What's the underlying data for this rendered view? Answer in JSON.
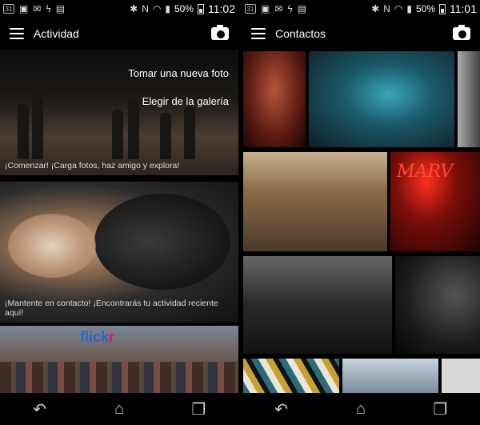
{
  "left": {
    "status": {
      "time": "11:02",
      "battery": "50%",
      "calendar": "31"
    },
    "app_title": "Actividad",
    "menu": [
      "Tomar una nueva foto",
      "Elegir de la galería"
    ],
    "cards": [
      {
        "caption": "¡Comenzar! ¡Carga fotos, haz amigo y explora!"
      },
      {
        "caption": "¡Mantente en contacto! ¡Encontrarás tu actividad reciente aquí!"
      },
      {
        "logo_main": "flick",
        "logo_accent": "r"
      }
    ]
  },
  "right": {
    "status": {
      "time": "11:01",
      "battery": "50%",
      "calendar": "31"
    },
    "app_title": "Contactos",
    "neon_text": "MARV"
  },
  "icons": {
    "menu": "hamburger-icon",
    "camera": "camera-icon",
    "back": "back-icon",
    "home": "home-icon",
    "recent": "recent-apps-icon"
  },
  "colors": {
    "flickr_blue": "#2a65c8",
    "flickr_pink": "#ff0084"
  }
}
